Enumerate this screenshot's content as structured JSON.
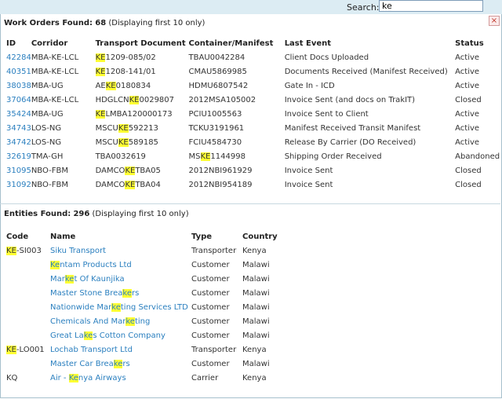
{
  "search": {
    "label": "Search:",
    "value": "ke",
    "highlight_term": "KE"
  },
  "panel": {
    "close_label": "×"
  },
  "work_orders": {
    "title_prefix": "Work Orders Found:",
    "count": "68",
    "title_suffix": "(Displaying first 10 only)",
    "columns": [
      "ID",
      "Corridor",
      "Transport Document",
      "Container/Manifest",
      "Last Event",
      "Status"
    ],
    "rows": [
      {
        "id": "42284",
        "corridor": "MBA-KE-LCL",
        "doc": "KE1209-085/02",
        "container": "TBAU0042284",
        "event": "Client Docs Uploaded",
        "status": "Active"
      },
      {
        "id": "40351",
        "corridor": "MBA-KE-LCL",
        "doc": "KE1208-141/01",
        "container": "CMAU5869985",
        "event": "Documents Received (Manifest Received)",
        "status": "Active"
      },
      {
        "id": "38038",
        "corridor": "MBA-UG",
        "doc": "AEKE0180834",
        "container": "HDMU6807542",
        "event": "Gate In - ICD",
        "status": "Active"
      },
      {
        "id": "37064",
        "corridor": "MBA-KE-LCL",
        "doc": "HDGLCNKE0029807",
        "container": "2012MSA105002",
        "event": "Invoice Sent (and docs on TrakIT)",
        "status": "Closed"
      },
      {
        "id": "35424",
        "corridor": "MBA-UG",
        "doc": "KELMBA120000173",
        "container": "PCIU1005563",
        "event": "Invoice Sent to Client",
        "status": "Active"
      },
      {
        "id": "34743",
        "corridor": "LOS-NG",
        "doc": "MSCUKE592213",
        "container": "TCKU3191961",
        "event": "Manifest Received Transit Manifest",
        "status": "Active"
      },
      {
        "id": "34742",
        "corridor": "LOS-NG",
        "doc": "MSCUKE589185",
        "container": "FCIU4584730",
        "event": "Release By Carrier (DO Received)",
        "status": "Active"
      },
      {
        "id": "32619",
        "corridor": "TMA-GH",
        "doc": "TBA0032619",
        "container": "MSKE1144998",
        "event": "Shipping Order Received",
        "status": "Abandoned"
      },
      {
        "id": "31095",
        "corridor": "NBO-FBM",
        "doc": "DAMCOKETBA05",
        "container": "2012NBI961929",
        "event": "Invoice Sent",
        "status": "Closed"
      },
      {
        "id": "31092",
        "corridor": "NBO-FBM",
        "doc": "DAMCOKETBA04",
        "container": "2012NBI954189",
        "event": "Invoice Sent",
        "status": "Closed"
      }
    ]
  },
  "entities": {
    "title_prefix": "Entities Found:",
    "count": "296",
    "title_suffix": "(Displaying first 10 only)",
    "columns": [
      "Code",
      "Name",
      "Type",
      "Country"
    ],
    "rows": [
      {
        "code": "KE-SI003",
        "name": "Siku Transport",
        "type": "Transporter",
        "country": "Kenya"
      },
      {
        "code": "",
        "name": "Kentam Products Ltd",
        "type": "Customer",
        "country": "Malawi"
      },
      {
        "code": "",
        "name": "Market Of Kaunjika",
        "type": "Customer",
        "country": "Malawi"
      },
      {
        "code": "",
        "name": "Master Stone Breakers",
        "type": "Customer",
        "country": "Malawi"
      },
      {
        "code": "",
        "name": "Nationwide Marketing Services LTD",
        "type": "Customer",
        "country": "Malawi"
      },
      {
        "code": "",
        "name": "Chemicals And Marketing",
        "type": "Customer",
        "country": "Malawi"
      },
      {
        "code": "",
        "name": "Great Lakes Cotton Company",
        "type": "Customer",
        "country": "Malawi"
      },
      {
        "code": "KE-LO001",
        "name": "Lochab Transport Ltd",
        "type": "Transporter",
        "country": "Kenya"
      },
      {
        "code": "",
        "name": "Master Car Breakers",
        "type": "Customer",
        "country": "Malawi"
      },
      {
        "code": "KQ",
        "name": "Air - Kenya Airways",
        "type": "Carrier",
        "country": "Kenya"
      }
    ]
  },
  "colors": {
    "link": "#2a7fbf",
    "highlight": "#ffff33",
    "topbar": "#dcecf3"
  }
}
